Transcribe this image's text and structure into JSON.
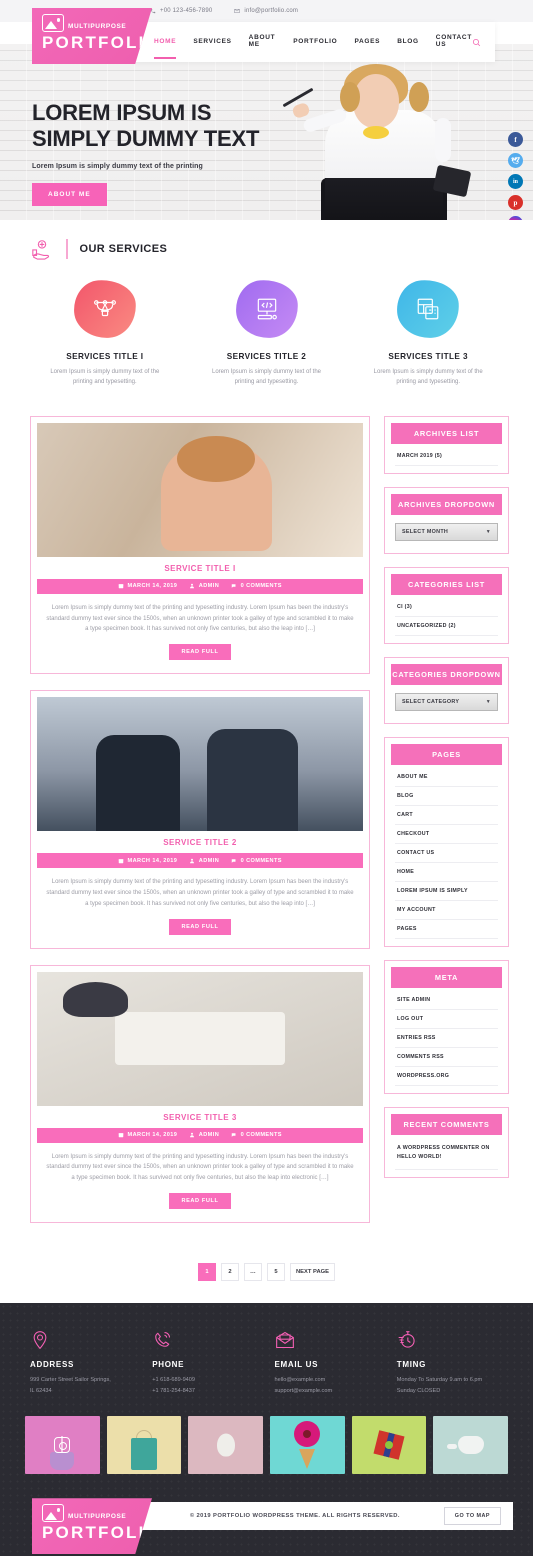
{
  "topbar": {
    "phone": "+00 123-456-7890",
    "email": "info@portfolio.com",
    "phone_icon": "phone-icon",
    "email_icon": "envelope-icon"
  },
  "logo": {
    "top": "MULTIPURPOSE",
    "main": "PORTFOLIO",
    "icon": "image-placeholder-icon"
  },
  "nav": {
    "items": [
      {
        "label": "HOME",
        "active": true
      },
      {
        "label": "SERVICES",
        "active": false
      },
      {
        "label": "ABOUT ME",
        "active": false
      },
      {
        "label": "PORTFOLIO",
        "active": false
      },
      {
        "label": "PAGES",
        "active": false
      },
      {
        "label": "BLOG",
        "active": false
      },
      {
        "label": "CONTACT US",
        "active": false
      }
    ],
    "search_icon": "search-icon"
  },
  "hero": {
    "title_line1": "LOREM IPSUM IS",
    "title_line2": "SIMPLY DUMMY TEXT",
    "subtitle": "Lorem Ipsum is simply dummy text of the printing",
    "button": "ABOUT ME",
    "social": [
      {
        "name": "facebook",
        "glyph": "f"
      },
      {
        "name": "twitter",
        "glyph": "🕊"
      },
      {
        "name": "linkedin",
        "glyph": "in"
      },
      {
        "name": "pinterest",
        "glyph": "p"
      },
      {
        "name": "instagram",
        "glyph": ""
      }
    ]
  },
  "services_section": {
    "heading": "OUR SERVICES",
    "heading_icon": "support-hand-icon",
    "items": [
      {
        "title": "SERVICES TITLE I",
        "text": "Lorem Ipsum is simply dummy text of the printing and typesetting.",
        "icon": "pen-tool-icon",
        "color": "#f2566b"
      },
      {
        "title": "SERVICES TITLE 2",
        "text": "Lorem Ipsum is simply dummy text of the printing and typesetting.",
        "icon": "code-monitor-icon",
        "color": "#a06bf0"
      },
      {
        "title": "SERVICES TITLE 3",
        "text": "Lorem Ipsum is simply dummy text of the printing and typesetting.",
        "icon": "layout-design-icon",
        "color": "#3fb6e8"
      }
    ]
  },
  "posts": [
    {
      "title": "SERVICE TITLE I",
      "date": "MARCH 14, 2019",
      "author": "ADMIN",
      "comments": "0 COMMENTS",
      "excerpt": "Lorem Ipsum is simply dummy text of the printing and typesetting industry. Lorem Ipsum has been the industry's standard dummy text ever since the 1500s, when an unknown printer took a galley of type and scrambled it to make a type specimen book. It has survived not only five centuries, but also the leap into […]",
      "button": "READ FULL"
    },
    {
      "title": "SERVICE TITLE 2",
      "date": "MARCH 14, 2019",
      "author": "ADMIN",
      "comments": "0 COMMENTS",
      "excerpt": "Lorem Ipsum is simply dummy text of the printing and typesetting industry. Lorem Ipsum has been the industry's standard dummy text ever since the 1500s, when an unknown printer took a galley of type and scrambled it to make a type specimen book. It has survived not only five centuries, but also the leap into […]",
      "button": "READ FULL"
    },
    {
      "title": "SERVICE TITLE 3",
      "date": "MARCH 14, 2019",
      "author": "ADMIN",
      "comments": "0 COMMENTS",
      "excerpt": "Lorem Ipsum is simply dummy text of the printing and typesetting industry. Lorem Ipsum has been the industry's standard dummy text ever since the 1500s, when an unknown printer took a galley of type and scrambled it to make a type specimen book. It has survived not only five centuries, but also the leap into electronic […]",
      "button": "READ FULL"
    }
  ],
  "sidebar": {
    "archives_list": {
      "title": "ARCHIVES LIST",
      "items": [
        "MARCH 2019 (5)"
      ]
    },
    "archives_dropdown": {
      "title": "ARCHIVES DROPDOWN",
      "selected": "SELECT MONTH",
      "caret": "▼"
    },
    "categories_list": {
      "title": "CATEGORIES LIST",
      "items": [
        "CI (3)",
        "UNCATEGORIZED (2)"
      ]
    },
    "categories_dropdown": {
      "title": "CATEGORIES DROPDOWN",
      "selected": "SELECT CATEGORY",
      "caret": "▼"
    },
    "pages": {
      "title": "PAGES",
      "items": [
        "ABOUT ME",
        "BLOG",
        "CART",
        "CHECKOUT",
        "CONTACT US",
        "HOME",
        "LOREM IPSUM IS SIMPLY",
        "MY ACCOUNT",
        "PAGES"
      ]
    },
    "meta": {
      "title": "META",
      "items": [
        "SITE ADMIN",
        "LOG OUT",
        "ENTRIES RSS",
        "COMMENTS RSS",
        "WORDPRESS.ORG"
      ]
    },
    "recent_comments": {
      "title": "RECENT COMMENTS",
      "items": [
        "A WORDPRESS COMMENTER ON HELLO WORLD!"
      ]
    }
  },
  "pagination": {
    "pages": [
      "1",
      "2",
      "…",
      "5"
    ],
    "active": "1",
    "next": "NEXT PAGE"
  },
  "footer": {
    "columns": [
      {
        "title": "ADDRESS",
        "icon": "location-pin-icon",
        "lines": [
          "999 Carter Street Sailor Springs,",
          "IL 62434"
        ]
      },
      {
        "title": "PHONE",
        "icon": "phone-ring-icon",
        "lines": [
          "+1 618-689-9409",
          "+1 781-254-8437"
        ]
      },
      {
        "title": "EMAIL US",
        "icon": "open-envelope-icon",
        "lines": [
          "hello@example.com",
          "support@example.com"
        ]
      },
      {
        "title": "TMING",
        "icon": "stopwatch-icon",
        "lines": [
          "Monday To Saturday 9.am to 6.pm",
          "Sunday CLOSED"
        ]
      }
    ],
    "gallery": [
      {
        "name": "cupcake-photo",
        "overlay_icon": "instagram-icon"
      },
      {
        "name": "shopping-bag-photo",
        "overlay_icon": ""
      },
      {
        "name": "egg-photo",
        "overlay_icon": ""
      },
      {
        "name": "flower-cone-photo",
        "overlay_icon": ""
      },
      {
        "name": "gift-box-photo",
        "overlay_icon": ""
      },
      {
        "name": "teapot-photo",
        "overlay_icon": ""
      }
    ],
    "copyright": "© 2019 PORTFOLIO WORDPRESS THEME. ALL RIGHTS RESERVED.",
    "map_button": "GO TO MAP"
  },
  "colors": {
    "brand_pink": "#f25fae",
    "brand_pink_light": "#f96dbb",
    "footer_dark": "#2b2b32",
    "text_dark": "#23232a",
    "text_muted": "#9a9aa4"
  }
}
